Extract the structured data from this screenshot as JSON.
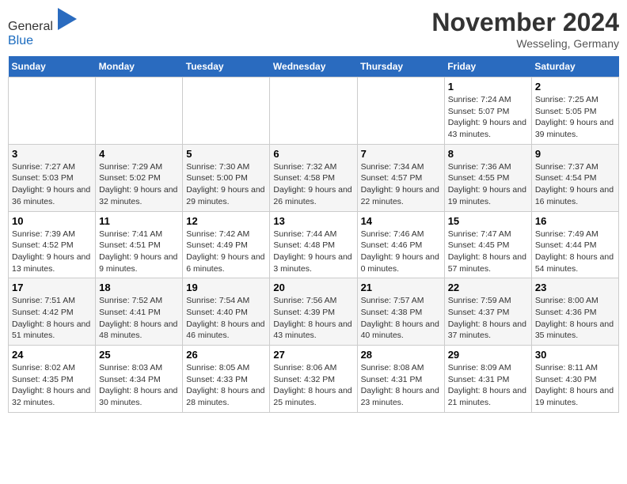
{
  "header": {
    "logo_general": "General",
    "logo_blue": "Blue",
    "month_title": "November 2024",
    "location": "Wesseling, Germany"
  },
  "weekdays": [
    "Sunday",
    "Monday",
    "Tuesday",
    "Wednesday",
    "Thursday",
    "Friday",
    "Saturday"
  ],
  "weeks": [
    [
      {
        "day": "",
        "info": ""
      },
      {
        "day": "",
        "info": ""
      },
      {
        "day": "",
        "info": ""
      },
      {
        "day": "",
        "info": ""
      },
      {
        "day": "",
        "info": ""
      },
      {
        "day": "1",
        "info": "Sunrise: 7:24 AM\nSunset: 5:07 PM\nDaylight: 9 hours and 43 minutes."
      },
      {
        "day": "2",
        "info": "Sunrise: 7:25 AM\nSunset: 5:05 PM\nDaylight: 9 hours and 39 minutes."
      }
    ],
    [
      {
        "day": "3",
        "info": "Sunrise: 7:27 AM\nSunset: 5:03 PM\nDaylight: 9 hours and 36 minutes."
      },
      {
        "day": "4",
        "info": "Sunrise: 7:29 AM\nSunset: 5:02 PM\nDaylight: 9 hours and 32 minutes."
      },
      {
        "day": "5",
        "info": "Sunrise: 7:30 AM\nSunset: 5:00 PM\nDaylight: 9 hours and 29 minutes."
      },
      {
        "day": "6",
        "info": "Sunrise: 7:32 AM\nSunset: 4:58 PM\nDaylight: 9 hours and 26 minutes."
      },
      {
        "day": "7",
        "info": "Sunrise: 7:34 AM\nSunset: 4:57 PM\nDaylight: 9 hours and 22 minutes."
      },
      {
        "day": "8",
        "info": "Sunrise: 7:36 AM\nSunset: 4:55 PM\nDaylight: 9 hours and 19 minutes."
      },
      {
        "day": "9",
        "info": "Sunrise: 7:37 AM\nSunset: 4:54 PM\nDaylight: 9 hours and 16 minutes."
      }
    ],
    [
      {
        "day": "10",
        "info": "Sunrise: 7:39 AM\nSunset: 4:52 PM\nDaylight: 9 hours and 13 minutes."
      },
      {
        "day": "11",
        "info": "Sunrise: 7:41 AM\nSunset: 4:51 PM\nDaylight: 9 hours and 9 minutes."
      },
      {
        "day": "12",
        "info": "Sunrise: 7:42 AM\nSunset: 4:49 PM\nDaylight: 9 hours and 6 minutes."
      },
      {
        "day": "13",
        "info": "Sunrise: 7:44 AM\nSunset: 4:48 PM\nDaylight: 9 hours and 3 minutes."
      },
      {
        "day": "14",
        "info": "Sunrise: 7:46 AM\nSunset: 4:46 PM\nDaylight: 9 hours and 0 minutes."
      },
      {
        "day": "15",
        "info": "Sunrise: 7:47 AM\nSunset: 4:45 PM\nDaylight: 8 hours and 57 minutes."
      },
      {
        "day": "16",
        "info": "Sunrise: 7:49 AM\nSunset: 4:44 PM\nDaylight: 8 hours and 54 minutes."
      }
    ],
    [
      {
        "day": "17",
        "info": "Sunrise: 7:51 AM\nSunset: 4:42 PM\nDaylight: 8 hours and 51 minutes."
      },
      {
        "day": "18",
        "info": "Sunrise: 7:52 AM\nSunset: 4:41 PM\nDaylight: 8 hours and 48 minutes."
      },
      {
        "day": "19",
        "info": "Sunrise: 7:54 AM\nSunset: 4:40 PM\nDaylight: 8 hours and 46 minutes."
      },
      {
        "day": "20",
        "info": "Sunrise: 7:56 AM\nSunset: 4:39 PM\nDaylight: 8 hours and 43 minutes."
      },
      {
        "day": "21",
        "info": "Sunrise: 7:57 AM\nSunset: 4:38 PM\nDaylight: 8 hours and 40 minutes."
      },
      {
        "day": "22",
        "info": "Sunrise: 7:59 AM\nSunset: 4:37 PM\nDaylight: 8 hours and 37 minutes."
      },
      {
        "day": "23",
        "info": "Sunrise: 8:00 AM\nSunset: 4:36 PM\nDaylight: 8 hours and 35 minutes."
      }
    ],
    [
      {
        "day": "24",
        "info": "Sunrise: 8:02 AM\nSunset: 4:35 PM\nDaylight: 8 hours and 32 minutes."
      },
      {
        "day": "25",
        "info": "Sunrise: 8:03 AM\nSunset: 4:34 PM\nDaylight: 8 hours and 30 minutes."
      },
      {
        "day": "26",
        "info": "Sunrise: 8:05 AM\nSunset: 4:33 PM\nDaylight: 8 hours and 28 minutes."
      },
      {
        "day": "27",
        "info": "Sunrise: 8:06 AM\nSunset: 4:32 PM\nDaylight: 8 hours and 25 minutes."
      },
      {
        "day": "28",
        "info": "Sunrise: 8:08 AM\nSunset: 4:31 PM\nDaylight: 8 hours and 23 minutes."
      },
      {
        "day": "29",
        "info": "Sunrise: 8:09 AM\nSunset: 4:31 PM\nDaylight: 8 hours and 21 minutes."
      },
      {
        "day": "30",
        "info": "Sunrise: 8:11 AM\nSunset: 4:30 PM\nDaylight: 8 hours and 19 minutes."
      }
    ]
  ]
}
